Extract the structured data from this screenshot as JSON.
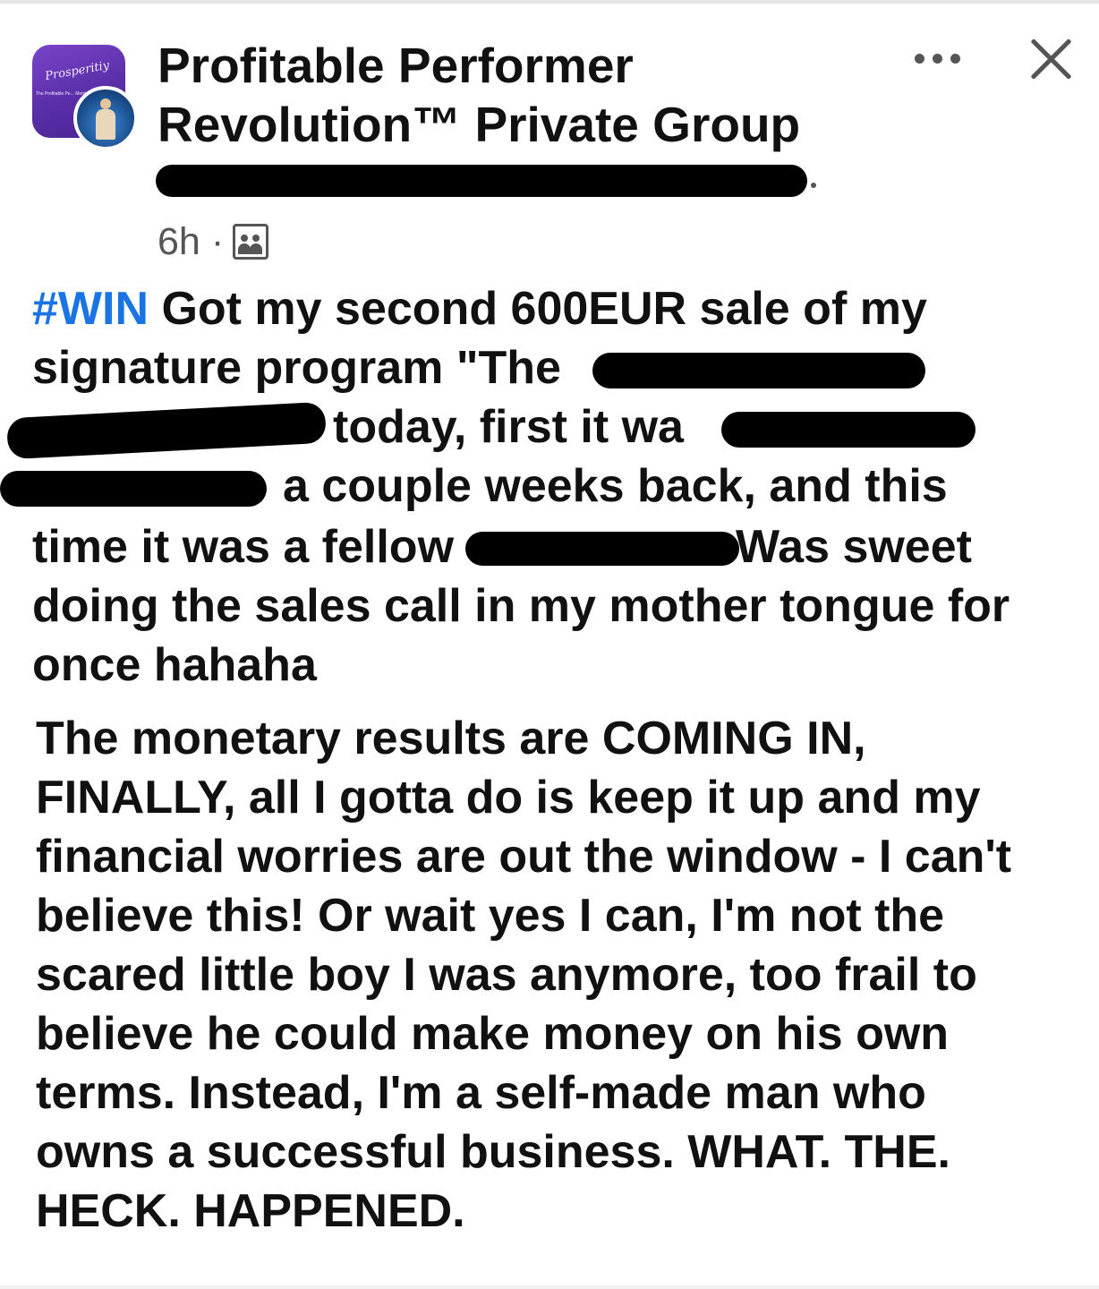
{
  "header": {
    "group_name_line1": "Profitable Performer",
    "group_name_line2": "Revolution™ Private Group",
    "avatar_text": "Prosperitiy",
    "avatar_subtext": "The Profitable Pe... Membershi...",
    "time": "6h",
    "separator": "·",
    "icons": [
      "more-icon",
      "close-icon",
      "group-members-icon"
    ]
  },
  "post": {
    "hashtag": "#WIN",
    "line1": " Got my second 600EUR sale of my",
    "line2": "signature program \"The",
    "line3": "today, first it wa",
    "line4": "a couple weeks back, and this",
    "line5a": "time it was a fellow",
    "line5b": "Was sweet",
    "line6": "doing the sales call in my mother tongue for",
    "line7": "once hahaha",
    "para2": [
      "The monetary results are COMING IN,",
      "FINALLY, all I gotta do is keep it up and my",
      "financial worries are out the window - I can't",
      "believe this! Or wait yes I can, I'm not the",
      "scared little boy I was anymore, too frail to",
      "believe he could make money on his own",
      "terms. Instead, I'm a self-made man who",
      "owns a successful business. WHAT. THE.",
      "HECK. HAPPENED."
    ]
  },
  "colors": {
    "hashtag": "#1b74e4",
    "text": "#111111",
    "meta": "#555555",
    "redaction": "#000000"
  }
}
